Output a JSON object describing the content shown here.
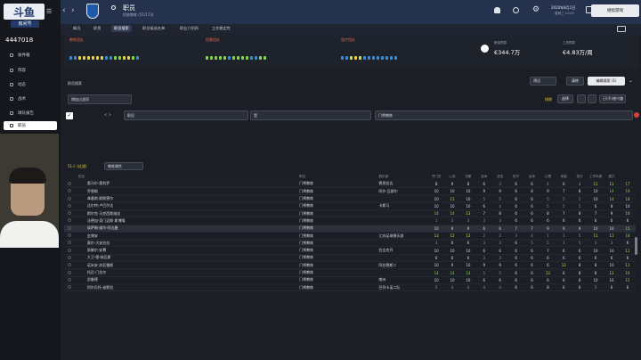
{
  "brand": {
    "line1": "斗鱼",
    "line2": "房间号",
    "room": "4447018"
  },
  "sidebar": {
    "items": [
      {
        "label": "收件箱"
      },
      {
        "label": "阵容"
      },
      {
        "label": "动态"
      },
      {
        "label": "战术"
      },
      {
        "label": "球队报告"
      },
      {
        "label": "职员"
      }
    ],
    "active": 5
  },
  "header": {
    "title": "职员",
    "subtitle": "招收教练 (51/173)",
    "date": "2020年8月1日",
    "weekday": "星期三 12:00",
    "continue_label": "继续游戏"
  },
  "tabs": [
    "概况",
    "职责",
    "职员搜索",
    "职员候选名单",
    "职业介绍所",
    "工作稳定性"
  ],
  "active_tab": 2,
  "summary": {
    "g1_label": "教练团队",
    "g2_label": "招募团队",
    "g3_label": "医疗团队",
    "wage_budget_label": "薪金预算",
    "wage_budget": "€344.7万",
    "wage_label": "工资预算",
    "wage": "€4.83万/周"
  },
  "colors": {
    "accent": "#e7d24b",
    "good": "#86d54f",
    "brand": "#213a6b"
  },
  "search": {
    "section_title": "职员搜索",
    "reset": "清除",
    "edit": "编辑搜索 (1)",
    "filter_placeholder": "增加过滤项",
    "exclude_label": "排除",
    "select_label": "选择",
    "interest_label": "已(不)感兴趣",
    "pre_label": "预设"
  },
  "rule": {
    "field": "职员",
    "op": "是",
    "value": "门将教练"
  },
  "results": {
    "label": "51人 (过滤)",
    "view": "教练属性"
  },
  "columns": [
    "姓名",
    "职位",
    "俱乐部",
    "角色",
    "守门员",
    "心态",
    "决断",
    "技术",
    "进攻",
    "防守",
    "战术",
    "心理",
    "体能",
    "执行",
    "工作年龄",
    "潜力"
  ],
  "rows": [
    {
      "name": "奥马尔·奥利罗",
      "role": "门将教练",
      "club": "德男拉达",
      "v": [
        "8",
        "9",
        "8",
        "6",
        "3",
        "6",
        "6",
        "4",
        "6",
        "4",
        "11",
        "11",
        "17"
      ]
    },
    {
      "name": "乔恩格",
      "role": "门将教练",
      "club": "阿尔·瓦斯尔",
      "v": [
        "10",
        "10",
        "10",
        "9",
        "9",
        "6",
        "8",
        "9",
        "7",
        "8",
        "10",
        "14",
        "19"
      ]
    },
    {
      "name": "弗基斯·斯斯德尔",
      "role": "门将教练",
      "club": "",
      "v": [
        "10",
        "11",
        "10",
        "5",
        "5",
        "6",
        "6",
        "5",
        "5",
        "5",
        "10",
        "14",
        "18"
      ]
    },
    {
      "name": "达尔特·卢巴尔达",
      "role": "门将教练",
      "club": "卡斯马",
      "v": [
        "10",
        "10",
        "10",
        "6",
        "4",
        "6",
        "6",
        "5",
        "5",
        "5",
        "6",
        "8",
        "10"
      ]
    },
    {
      "name": "斯尔克·马克西斯维丝",
      "role": "门将教练",
      "club": "",
      "v": [
        "14",
        "14",
        "13",
        "7",
        "8",
        "6",
        "6",
        "8",
        "7",
        "8",
        "7",
        "9",
        "18"
      ]
    },
    {
      "name": "法德加·奇门迈斯·斯博隆",
      "role": "门将教练",
      "club": "",
      "v": [
        "1",
        "3",
        "3",
        "3",
        "3",
        "6",
        "6",
        "6",
        "6",
        "6",
        "6",
        "6",
        "6"
      ]
    },
    {
      "name": "埃萨姆·维尔·阿达曼",
      "role": "门将教练",
      "club": "",
      "v": [
        "10",
        "9",
        "9",
        "6",
        "6",
        "7",
        "7",
        "9",
        "9",
        "9",
        "10",
        "10",
        "15"
      ]
    },
    {
      "name": "金博安",
      "role": "门将教练",
      "club": "江苏足球俱乐部",
      "v": [
        "13",
        "12",
        "12",
        "2",
        "2",
        "3",
        "4",
        "1",
        "1",
        "5",
        "11",
        "11",
        "18"
      ]
    },
    {
      "name": "莫尔·大安拉拉",
      "role": "门将教练",
      "club": "",
      "v": [
        "3",
        "6",
        "6",
        "3",
        "3",
        "6",
        "5",
        "5",
        "3",
        "5",
        "3",
        "3",
        "6"
      ]
    },
    {
      "name": "努佛尔·安慕",
      "role": "门将教练",
      "club": "拉吉克丹",
      "v": [
        "10",
        "10",
        "10",
        "6",
        "6",
        "6",
        "6",
        "7",
        "6",
        "6",
        "10",
        "10",
        "11"
      ]
    },
    {
      "name": "大卫·德·纳瓦斯",
      "role": "门将教练",
      "club": "",
      "v": [
        "6",
        "6",
        "6",
        "3",
        "3",
        "6",
        "6",
        "6",
        "6",
        "6",
        "6",
        "6",
        "6"
      ]
    },
    {
      "name": "诺米安·苏亚雷斯",
      "role": "门将教练",
      "club": "阿拉德斯二",
      "v": [
        "10",
        "9",
        "10",
        "9",
        "9",
        "6",
        "6",
        "6",
        "12",
        "8",
        "8",
        "10",
        "11"
      ]
    },
    {
      "name": "托尼·门拉尔",
      "role": "门将教练",
      "club": "",
      "v": [
        "14",
        "14",
        "14",
        "5",
        "5",
        "6",
        "6",
        "13",
        "6",
        "8",
        "8",
        "11",
        "16"
      ]
    },
    {
      "name": "凯鲁德",
      "role": "门将教练",
      "club": "南州",
      "v": [
        "10",
        "10",
        "10",
        "6",
        "6",
        "6",
        "6",
        "6",
        "6",
        "6",
        "10",
        "10",
        "15"
      ]
    },
    {
      "name": "阿尔贝托·迪默拉",
      "role": "门将教练",
      "club": "巴列卡诺二队",
      "v": [
        "5",
        "4",
        "4",
        "4",
        "4",
        "6",
        "6",
        "8",
        "6",
        "6",
        "5",
        "6",
        "6"
      ]
    }
  ]
}
